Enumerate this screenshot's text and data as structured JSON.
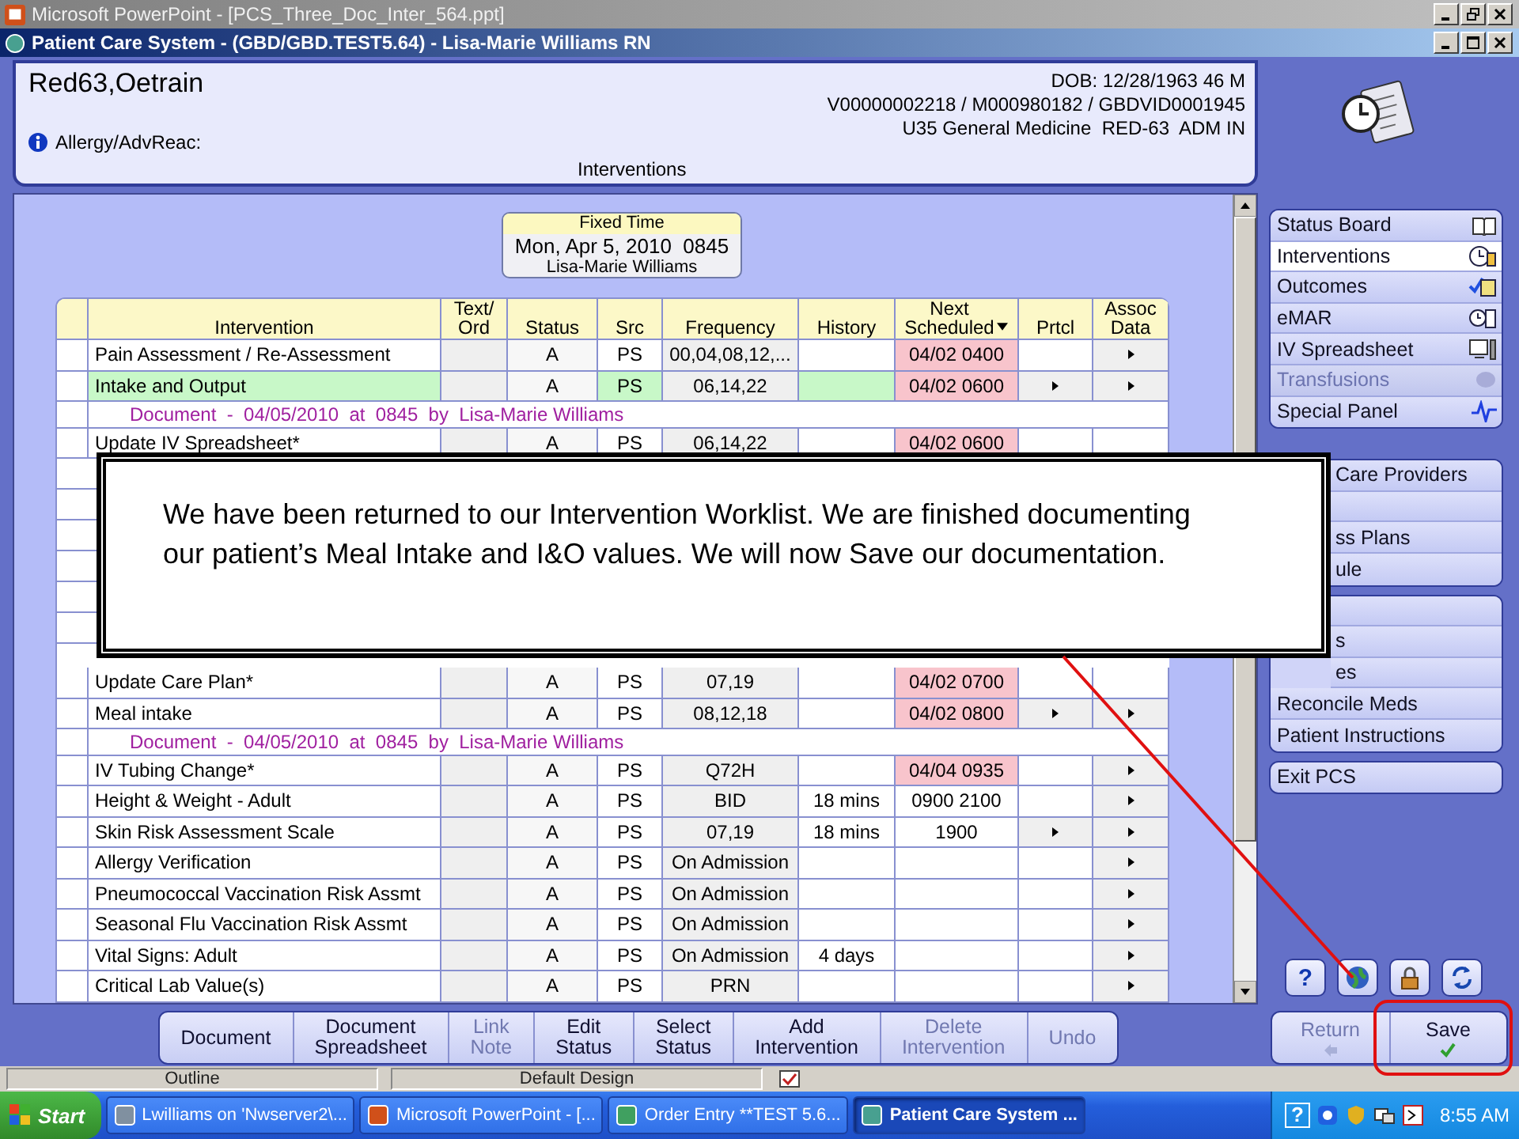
{
  "ppt_window": {
    "title": "Microsoft PowerPoint - [PCS_Three_Doc_Inter_564.ppt]"
  },
  "app_window": {
    "title": "Patient Care System - (GBD/GBD.TEST5.64) - Lisa-Marie Williams RN"
  },
  "patient": {
    "name": "Red63,Oetrain",
    "dob": "DOB: 12/28/1963 46 M",
    "ids": "V00000002218 / M000980182 / GBDVID0001945",
    "location": "U35 General Medicine  RED-63  ADM IN",
    "allergy_label": "Allergy/AdvReac:",
    "section_title": "Interventions"
  },
  "fixed_time": {
    "heading": "Fixed Time",
    "datetime": "Mon, Apr 5, 2010  0845",
    "user": "Lisa-Marie Williams"
  },
  "table": {
    "columns": [
      "Intervention",
      "Text/\nOrd",
      "Status",
      "Src",
      "Frequency",
      "History",
      "Next\nScheduled",
      "Prtcl",
      "Assoc\nData"
    ],
    "rows_top": [
      {
        "kind": "item",
        "intervention": "Pain Assessment / Re-Assessment",
        "status": "A",
        "src": "PS",
        "frequency": "00,04,08,12,...",
        "next_scheduled": "04/02 0400",
        "overdue": true,
        "highlighted": false,
        "prtcl": false,
        "assoc": true
      },
      {
        "kind": "item",
        "intervention": "Intake and Output",
        "status": "A",
        "src": "PS",
        "frequency": "06,14,22",
        "next_scheduled": "04/02 0600",
        "overdue": true,
        "highlighted": true,
        "prtcl": true,
        "assoc": true
      },
      {
        "kind": "document",
        "text": "Document  -  04/05/2010  at  0845  by  Lisa-Marie Williams"
      },
      {
        "kind": "item",
        "intervention": "Update IV Spreadsheet*",
        "status": "A",
        "src": "PS",
        "frequency": "06,14,22",
        "next_scheduled": "04/02 0600",
        "overdue": true,
        "highlighted": false,
        "prtcl": false,
        "assoc": false
      }
    ],
    "rows_bottom": [
      {
        "kind": "item",
        "intervention": "Update Care Plan*",
        "status": "A",
        "src": "PS",
        "frequency": "07,19",
        "next_scheduled": "04/02 0700",
        "overdue": true,
        "highlighted": false,
        "prtcl": false,
        "assoc": false
      },
      {
        "kind": "item",
        "intervention": "Meal intake",
        "status": "A",
        "src": "PS",
        "frequency": "08,12,18",
        "next_scheduled": "04/02 0800",
        "overdue": true,
        "highlighted": false,
        "prtcl": true,
        "assoc": true
      },
      {
        "kind": "document",
        "text": "Document  -  04/05/2010  at  0845  by  Lisa-Marie Williams"
      },
      {
        "kind": "item",
        "intervention": "IV Tubing Change*",
        "status": "A",
        "src": "PS",
        "frequency": "Q72H",
        "next_scheduled": "04/04 0935",
        "overdue": true,
        "highlighted": false,
        "prtcl": false,
        "assoc": true
      },
      {
        "kind": "item",
        "intervention": "Height & Weight - Adult",
        "status": "A",
        "src": "PS",
        "frequency": "BID",
        "history": "18 mins",
        "next_scheduled": "0900 2100",
        "overdue": false,
        "highlighted": false,
        "prtcl": false,
        "assoc": true
      },
      {
        "kind": "item",
        "intervention": "Skin Risk Assessment Scale",
        "status": "A",
        "src": "PS",
        "frequency": "07,19",
        "history": "18 mins",
        "next_scheduled": "1900",
        "overdue": false,
        "highlighted": false,
        "prtcl": true,
        "assoc": true
      },
      {
        "kind": "item",
        "intervention": "Allergy Verification",
        "status": "A",
        "src": "PS",
        "frequency": "On Admission",
        "overdue": false,
        "highlighted": false,
        "prtcl": false,
        "assoc": true
      },
      {
        "kind": "item",
        "intervention": "Pneumococcal Vaccination Risk Assmt",
        "status": "A",
        "src": "PS",
        "frequency": "On Admission",
        "overdue": false,
        "highlighted": false,
        "prtcl": false,
        "assoc": true
      },
      {
        "kind": "item",
        "intervention": "Seasonal Flu Vaccination Risk Assmt",
        "status": "A",
        "src": "PS",
        "frequency": "On Admission",
        "overdue": false,
        "highlighted": false,
        "prtcl": false,
        "assoc": true
      },
      {
        "kind": "item",
        "intervention": "Vital Signs: Adult",
        "status": "A",
        "src": "PS",
        "frequency": "On Admission",
        "history": "4 days",
        "overdue": false,
        "highlighted": false,
        "prtcl": false,
        "assoc": true
      },
      {
        "kind": "item",
        "intervention": "Critical Lab Value(s)",
        "status": "A",
        "src": "PS",
        "frequency": "PRN",
        "overdue": false,
        "highlighted": false,
        "prtcl": false,
        "assoc": true
      }
    ]
  },
  "sidebar": {
    "groups": [
      {
        "items": [
          {
            "label": "Status Board",
            "selected": false,
            "disabled": false,
            "covered": false
          },
          {
            "label": "Interventions",
            "selected": true,
            "disabled": false,
            "covered": false
          },
          {
            "label": "Outcomes",
            "selected": false,
            "disabled": false,
            "covered": false
          },
          {
            "label": "eMAR",
            "selected": false,
            "disabled": false,
            "covered": false
          },
          {
            "label": "IV Spreadsheet",
            "selected": false,
            "disabled": false,
            "covered": false
          },
          {
            "label": "Transfusions",
            "selected": false,
            "disabled": true,
            "covered": false
          },
          {
            "label": "Special Panel",
            "selected": false,
            "disabled": false,
            "covered": false
          }
        ]
      },
      {
        "items": [
          {
            "label": "Care Providers",
            "selected": false,
            "disabled": false,
            "covered": true
          },
          {
            "selected": false,
            "disabled": false,
            "covered": true
          },
          {
            "label": "ss Plans",
            "selected": false,
            "disabled": false,
            "covered": true
          },
          {
            "label": "ule",
            "selected": false,
            "disabled": false,
            "covered": true
          }
        ]
      },
      {
        "items": [
          {
            "selected": false,
            "disabled": false,
            "covered": true
          },
          {
            "label": "s",
            "selected": false,
            "disabled": false,
            "covered": true
          },
          {
            "label": "es",
            "selected": false,
            "disabled": false,
            "covered": true
          },
          {
            "label": "Reconcile Meds",
            "selected": false,
            "disabled": false,
            "covered": false
          },
          {
            "label": "Patient Instructions",
            "selected": false,
            "disabled": false,
            "covered": false
          }
        ]
      },
      {
        "items": [
          {
            "label": "Exit PCS",
            "selected": false,
            "disabled": false,
            "covered": false
          }
        ]
      }
    ]
  },
  "help_button": {
    "label": "?"
  },
  "toolbar": {
    "buttons": [
      {
        "label": "Document",
        "disabled": false
      },
      {
        "label": "Document\nSpreadsheet",
        "disabled": false
      },
      {
        "label": "Link\nNote",
        "disabled": true
      },
      {
        "label": "Edit\nStatus",
        "disabled": false
      },
      {
        "label": "Select\nStatus",
        "disabled": false
      },
      {
        "label": "Add\nIntervention",
        "disabled": false
      },
      {
        "label": "Delete\nIntervention",
        "disabled": true
      },
      {
        "label": "Undo",
        "disabled": true
      }
    ]
  },
  "return_button": {
    "label": "Return",
    "disabled": true
  },
  "save_button": {
    "label": "Save",
    "disabled": false
  },
  "callout": {
    "text": "We have been returned to our Intervention Worklist. We are finished documenting our patient’s Meal Intake and I&O values. We will now Save our documentation."
  },
  "ppt_status": {
    "panes": [
      "Outline",
      "Default Design"
    ]
  },
  "taskbar": {
    "start": "Start",
    "tasks": [
      {
        "label": "Lwilliams on 'Nwserver2\\...",
        "selected": false
      },
      {
        "label": "Microsoft PowerPoint - [...",
        "selected": false
      },
      {
        "label": "Order Entry **TEST 5.6...",
        "selected": false
      },
      {
        "label": "Patient Care System ...",
        "selected": true
      }
    ],
    "clock": "8:55 AM"
  }
}
